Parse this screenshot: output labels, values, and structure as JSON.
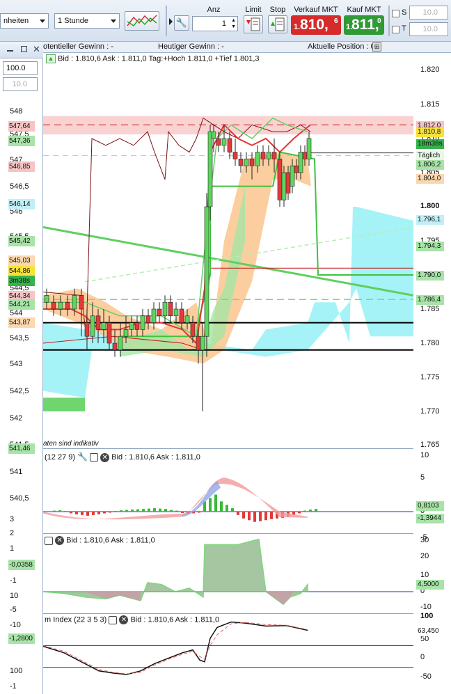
{
  "toolbar": {
    "combo1": "nheiten",
    "combo2": "1 Stunde",
    "anz_label": "Anz",
    "anz_value": "1",
    "limit_label": "Limit",
    "stop_label": "Stop",
    "sell_label": "Verkauf MKT",
    "buy_label": "Kauf MKT",
    "sell_small": "1.",
    "sell_big": "810,",
    "sell_sup": "6",
    "buy_small": "1.",
    "buy_big": "811,",
    "buy_sup": "0",
    "s_label": "S",
    "t_label": "T",
    "s_value": "10.0",
    "t_value": "10.0"
  },
  "left_panel": {
    "field1": "100.0",
    "field2": "10.0",
    "ticks": [
      "548",
      "547,5",
      "547",
      "546,5",
      "546",
      "545,5",
      "545",
      "544,5",
      "544",
      "543,5",
      "543",
      "542,5",
      "542",
      "541,5",
      "541",
      "540,5",
      "3",
      "2",
      "1",
      "0",
      "-1",
      "10",
      "-5",
      "-10",
      "100",
      "-1"
    ],
    "tags": [
      {
        "text": "547,64",
        "color": "#f5c4c4"
      },
      {
        "text": "547,36",
        "color": "#a8e3a8"
      },
      {
        "text": "546,85",
        "color": "#f5c4c4"
      },
      {
        "text": "546,14",
        "color": "#c0f0f6"
      },
      {
        "text": "545,42",
        "color": "#a8e3a8"
      },
      {
        "text": "545,03",
        "color": "#fbd8b0"
      },
      {
        "text": "544,86",
        "color": "#f7e23c"
      },
      {
        "text": "3m38s",
        "color": "#37b24d"
      },
      {
        "text": "544,34",
        "color": "#f5c4c4"
      },
      {
        "text": "544,21",
        "color": "#a8e3a8"
      },
      {
        "text": "543,87",
        "color": "#fbd8b0"
      },
      {
        "text": "541,46",
        "color": "#a8e3a8"
      },
      {
        "text": "-0,0358",
        "color": "#a8e3a8"
      },
      {
        "text": "-1,2800",
        "color": "#a8e3a8"
      }
    ]
  },
  "chart": {
    "summary": {
      "pot_gain": "otentieller Gewinn : -",
      "today_gain": "Heutiger Gewinn : -",
      "position": "Aktuelle Position : 0"
    },
    "main_header": "Bid : 1.810,6 Ask : 1.811,0 Tag:+Hoch 1.811,0 +Tief 1.801,3",
    "indikativ": "aten sind indikativ",
    "macd_header_name": "(12 27 9)",
    "macd_header_bid": "Bid : 1.810,6 Ask : 1.811,0",
    "osc_header_bid": "Bid : 1.810,6 Ask : 1.811,0",
    "mom_header_name": "m Index (22 3 5 3)",
    "mom_header_bid": "Bid : 1.810,6 Ask : 1.811,0"
  },
  "axis": {
    "main_ticks": [
      "1.820",
      "1.815",
      "1.810",
      "1.805",
      "1.800",
      "1.795",
      "1.790",
      "1.785",
      "1.780",
      "1.775",
      "1.770",
      "1.765"
    ],
    "main_tags": [
      {
        "text": "1.812,0",
        "color": "#f5c4c4"
      },
      {
        "text": "1.810,8",
        "color": "#f7e23c"
      },
      {
        "text": "18m38s",
        "color": "#37b24d"
      },
      {
        "text": "Täglich",
        "color": "#e8f7e8"
      },
      {
        "text": "1.806,2",
        "color": "#a8e3a8"
      },
      {
        "text": "1.804,0",
        "color": "#fbd8b0"
      },
      {
        "text": "1.796,1",
        "color": "#c0f0f6"
      },
      {
        "text": "1.794,3",
        "color": "#a8e3a8"
      },
      {
        "text": "1.790,0",
        "color": "#a8e3a8"
      },
      {
        "text": "1.786,4",
        "color": "#a8e3a8"
      }
    ],
    "macd_ticks": [
      "10",
      "5",
      "0",
      "-5"
    ],
    "macd_tags": [
      {
        "text": "0,8103",
        "color": "#a8e3a8"
      },
      {
        "text": "-1,3944",
        "color": "#a8e3a8"
      }
    ],
    "osc_ticks": [
      "30",
      "20",
      "10",
      "0",
      "-10"
    ],
    "osc_tags": [
      {
        "text": "4,5000",
        "color": "#a8e3a8"
      }
    ],
    "mom_ticks": [
      "100",
      "50",
      "0",
      "-50"
    ],
    "mom_tags": [
      {
        "text": "63,450",
        "color": "#ffffff"
      }
    ]
  },
  "chart_data": {
    "type": "line",
    "title": "",
    "ylim": [
      1765,
      1820
    ],
    "price_levels": {
      "high": 1811.0,
      "low": 1801.3,
      "bid": 1810.6,
      "ask": 1811.0
    },
    "horizontal_lines": [
      1783.0,
      1779.0,
      1812.0,
      1807.9,
      1786.4,
      1790.0
    ]
  }
}
